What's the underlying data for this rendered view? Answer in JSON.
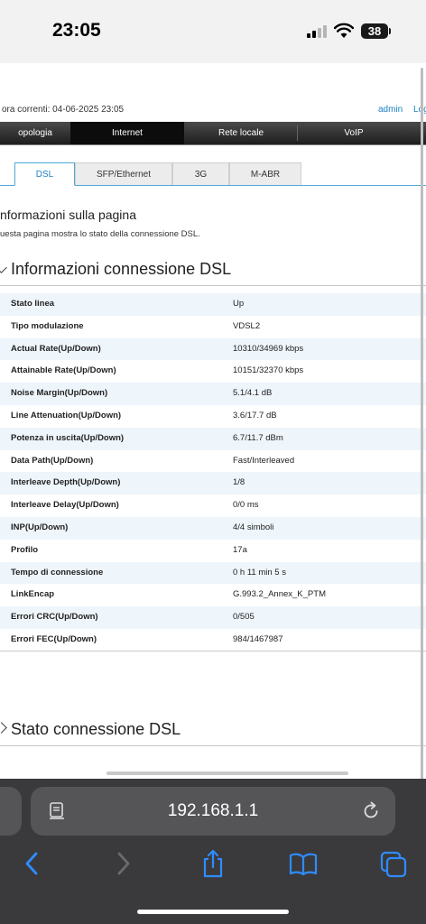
{
  "status_bar": {
    "time": "23:05",
    "battery": "38"
  },
  "header": {
    "datetime": "ora correnti: 04-06-2025 23:05",
    "admin": "admin",
    "logout": "Log"
  },
  "nav": [
    {
      "label": "opologia",
      "active": false
    },
    {
      "label": "Internet",
      "active": true
    },
    {
      "label": "Rete locale",
      "active": false
    },
    {
      "label": "VoIP",
      "active": false
    }
  ],
  "tabs": [
    {
      "label": "DSL",
      "active": true
    },
    {
      "label": "SFP/Ethernet",
      "active": false
    },
    {
      "label": "3G",
      "active": false
    },
    {
      "label": "M-ABR",
      "active": false
    }
  ],
  "page_info": {
    "title": "nformazioni sulla pagina",
    "description": "uesta pagina mostra lo stato della connessione DSL."
  },
  "section1": {
    "title": "Informazioni connessione DSL"
  },
  "dsl_info": [
    {
      "label": "Stato linea",
      "value": "Up"
    },
    {
      "label": "Tipo modulazione",
      "value": "VDSL2"
    },
    {
      "label": "Actual Rate(Up/Down)",
      "value": "10310/34969 kbps"
    },
    {
      "label": "Attainable Rate(Up/Down)",
      "value": "10151/32370 kbps"
    },
    {
      "label": "Noise Margin(Up/Down)",
      "value": "5.1/4.1 dB"
    },
    {
      "label": "Line Attenuation(Up/Down)",
      "value": "3.6/17.7 dB"
    },
    {
      "label": "Potenza in uscita(Up/Down)",
      "value": "6.7/11.7 dBm"
    },
    {
      "label": "Data Path(Up/Down)",
      "value": "Fast/Interleaved"
    },
    {
      "label": "Interleave Depth(Up/Down)",
      "value": "1/8"
    },
    {
      "label": "Interleave Delay(Up/Down)",
      "value": "0/0 ms"
    },
    {
      "label": "INP(Up/Down)",
      "value": "4/4 simboli"
    },
    {
      "label": "Profilo",
      "value": "17a"
    },
    {
      "label": "Tempo di connessione",
      "value": "0 h 11 min 5 s"
    },
    {
      "label": "LinkEncap",
      "value": "G.993.2_Annex_K_PTM"
    },
    {
      "label": "Errori CRC(Up/Down)",
      "value": "0/505"
    },
    {
      "label": "Errori FEC(Up/Down)",
      "value": "984/1467987"
    }
  ],
  "section2": {
    "title": "Stato connessione DSL"
  },
  "browser": {
    "url": "192.168.1.1",
    "icons": [
      "reader-icon",
      "reload-icon",
      "back-icon",
      "forward-icon",
      "share-icon",
      "bookmarks-icon",
      "tabs-icon"
    ]
  }
}
